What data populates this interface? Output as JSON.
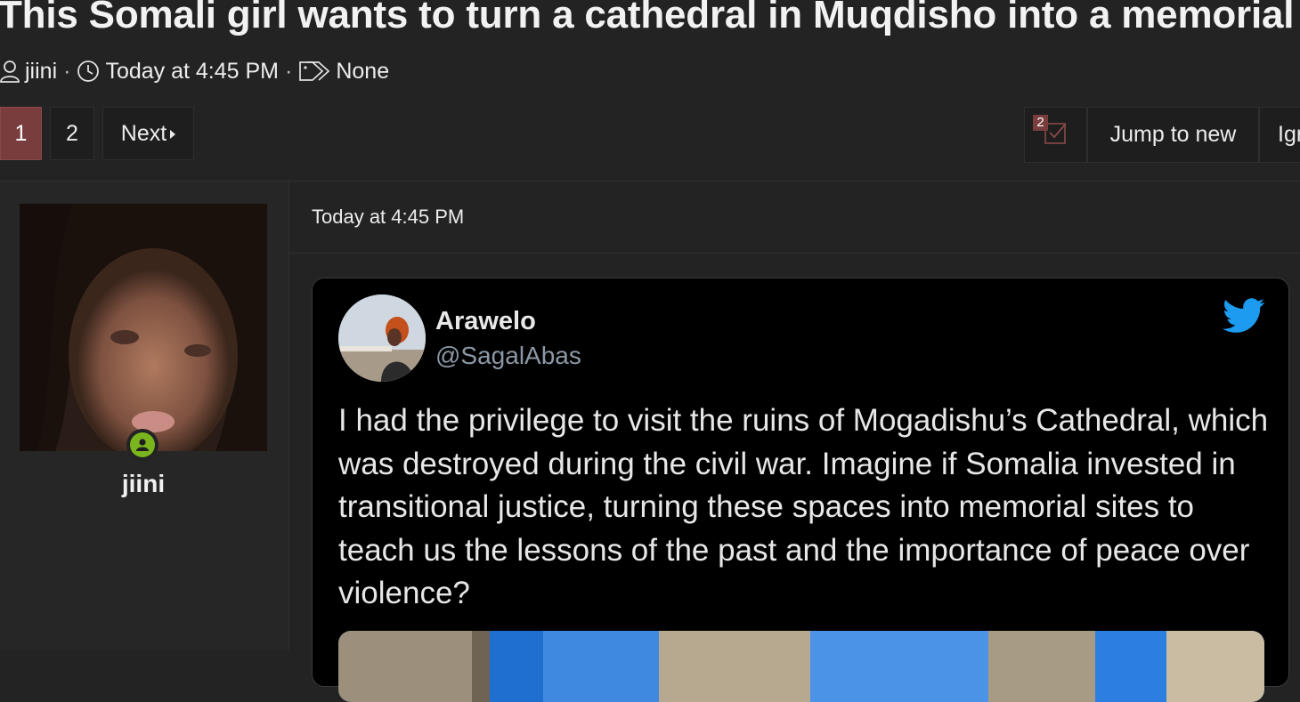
{
  "thread": {
    "title": "This Somali girl wants to turn a cathedral in Muqdisho into a memorial",
    "author": "jiini",
    "time": "Today at 4:45 PM",
    "tags": "None"
  },
  "pagination": {
    "pages": [
      "1",
      "2"
    ],
    "current_page": "1",
    "next_label": "Next"
  },
  "actions": {
    "unread_count": "2",
    "jump_label": "Jump to new",
    "ignore_label": "Ignore"
  },
  "post": {
    "username": "jiini",
    "time": "Today at 4:45 PM"
  },
  "tweet": {
    "name": "Arawelo",
    "handle": "@SagalAbas",
    "text": "I had the privilege to visit the ruins of Mogadishu’s Cathedral, which was destroyed during the civil war. Imagine if Somalia invested in transitional justice, turning these spaces into memorial sites to teach us the lessons of the past and the importance of peace over violence?"
  },
  "colors": {
    "background": "#232323",
    "accent": "#7a3d3d",
    "online": "#7ab51d",
    "twitter": "#1d9bf0"
  },
  "icons": [
    "user-icon",
    "clock-icon",
    "tag-icon",
    "checkbox-icon",
    "twitter-bird-icon",
    "online-status-icon"
  ]
}
